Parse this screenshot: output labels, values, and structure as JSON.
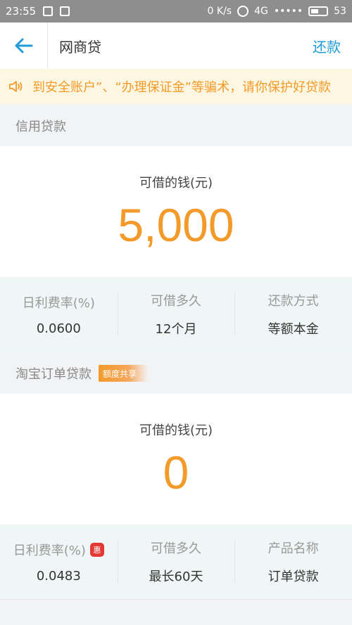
{
  "status_bar": {
    "time": "23:55",
    "speed": "0 K/s",
    "network": "4G",
    "signal": "•••••",
    "battery": "53"
  },
  "nav": {
    "title": "网商贷",
    "action": "还款"
  },
  "notice": {
    "text": "到安全账户”、“办理保证金”等骗术，请你保护好贷款"
  },
  "credit_loan": {
    "section_title": "信用贷款",
    "amount_label": "可借的钱(元)",
    "amount": "5,000",
    "stats": [
      {
        "label": "日利费率(%)",
        "value": "0.0600"
      },
      {
        "label": "可借多久",
        "value": "12个月"
      },
      {
        "label": "还款方式",
        "value": "等额本金"
      }
    ]
  },
  "taobao_loan": {
    "section_title": "淘宝订单贷款",
    "tag": "额度共享",
    "amount_label": "可借的钱(元)",
    "amount": "0",
    "badge": "惠",
    "stats": [
      {
        "label": "日利费率(%)",
        "value": "0.0483"
      },
      {
        "label": "可借多久",
        "value": "最长60天"
      },
      {
        "label": "产品名称",
        "value": "订单贷款"
      }
    ]
  },
  "colors": {
    "accent_orange": "#f39a2a",
    "link_blue": "#1e9bd8",
    "badge_red": "#e53935"
  }
}
